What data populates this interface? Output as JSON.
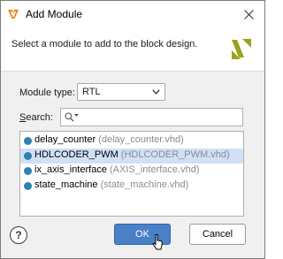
{
  "window": {
    "title": "Add Module",
    "app_icon": "vivado-logo-icon",
    "close_icon": "close-icon"
  },
  "header": {
    "prompt": "Select a module to add to the block design.",
    "logo": "xilinx-logo-icon",
    "logo_color": "#9aa21e"
  },
  "module_type": {
    "label": "Module type:",
    "selected": "RTL"
  },
  "search": {
    "label_mnemonic": "S",
    "label_rest": "earch:",
    "value": "",
    "placeholder": ""
  },
  "modules": [
    {
      "name": "delay_counter",
      "file": "(delay_counter.vhd)",
      "selected": false
    },
    {
      "name": "HDLCODER_PWM",
      "file": "(HDLCODER_PWM.vhd)",
      "selected": true
    },
    {
      "name": "ix_axis_interface",
      "file": "(AXIS_interface.vhd)",
      "selected": false
    },
    {
      "name": "state_machine",
      "file": "(state_machine.vhd)",
      "selected": false
    }
  ],
  "footer": {
    "help_label": "?",
    "ok_label": "OK",
    "cancel_label": "Cancel"
  },
  "colors": {
    "accent": "#4a80c6",
    "selection": "#cfe0f7",
    "module_dot": "#2f7fb0",
    "file_text": "#8c8c8c"
  }
}
